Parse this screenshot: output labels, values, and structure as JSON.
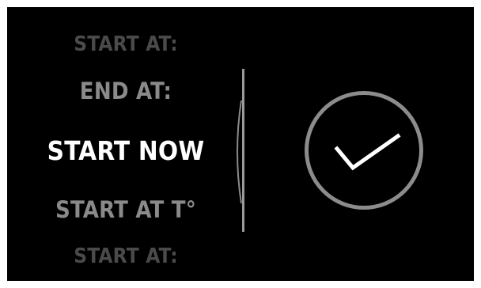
{
  "picker": {
    "options": [
      "START AT:",
      "END AT:",
      "START NOW",
      "START AT T°",
      "START AT:"
    ],
    "selected": "START NOW"
  },
  "confirm": {
    "icon": "checkmark-icon",
    "ring_color": "#8c8c8c",
    "check_color": "#ffffff"
  },
  "colors": {
    "background": "#000000",
    "selected_text": "#ffffff",
    "near_text": "#8a8a8a",
    "far_text": "#4a4a4a"
  }
}
